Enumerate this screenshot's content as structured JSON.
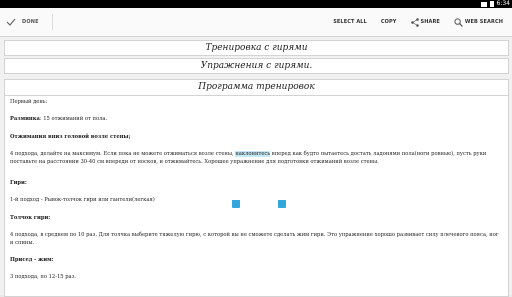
{
  "status_bar": {
    "time": "6:34"
  },
  "action_bar": {
    "done_label": "DONE",
    "actions": [
      {
        "label": "SELECT ALL"
      },
      {
        "label": "COPY"
      },
      {
        "label": "SHARE"
      },
      {
        "label": "WEB SEARCH"
      }
    ]
  },
  "panels": [
    {
      "title": "Тренировка с гирями"
    },
    {
      "title": "Упражнения с гирями."
    },
    {
      "title": "Программа тренировок"
    }
  ],
  "article": {
    "day": "Первый день:",
    "warmup_label": "Разминка",
    "warmup_text": ": 15 отжиманий от пола.",
    "pushups_heading": "Отжимания вниз головой возле стены;",
    "pushups_text_a": "4 подхода, делайте на максимум. Если пока не можете отжиматься возле стены, ",
    "pushups_highlight": "наклонитесь",
    "pushups_text_b": " вперед как будто пытаетесь достать ладонями пола(ноги ровные), пусть руки поставьте на расстоянии 30-40 см впереди от носков, и отжимайтесь. Хорошее упражнение для подготовки отжиманий возле стены.",
    "weights_heading": "Гири:",
    "weights_text": "1-й подход - Рывок-толчок гири или гантели(легкая)",
    "clean_heading": "Толчок гири:",
    "clean_text": "4 подхода, в среднем по 10 раз. Для толчка выберите тяжелую гирю, с которой вы не сможете сделать жим гири. Это упражнение хорошо развивает силу плечевого пояса, ног и спины.",
    "squat_heading": "Присед - жим:",
    "squat_text": "3 подхода, по 12-15 раз."
  }
}
